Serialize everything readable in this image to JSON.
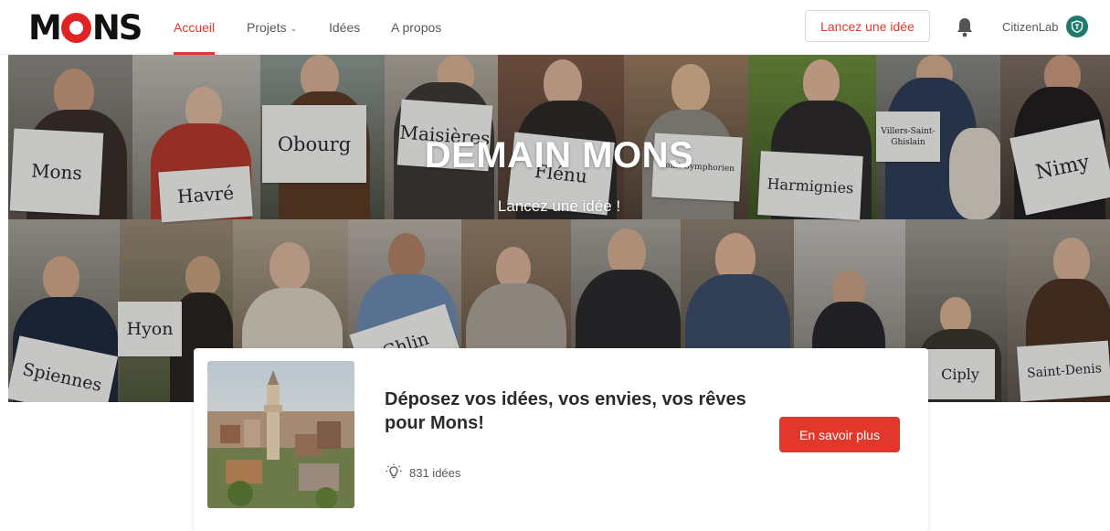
{
  "brand": {
    "logo_text_left": "M",
    "logo_text_right": "NS",
    "accent": "#e2382c"
  },
  "nav": {
    "items": [
      {
        "label": "Accueil"
      },
      {
        "label": "Projets"
      },
      {
        "label": "Idées"
      },
      {
        "label": "A propos"
      }
    ],
    "cta_label": "Lancez une idée",
    "bell_icon": "bell-icon",
    "user_name": "CitizenLab"
  },
  "hero": {
    "title": "DEMAIN MONS",
    "subtitle": "Lancez une idée !",
    "signs": [
      "Mons",
      "Havré",
      "Obourg",
      "Maisières",
      "Flénu",
      "Saint-Symphorien",
      "Harmignies",
      "Villers-Saint-Ghislain",
      "Nimy",
      "Hyon",
      "Ghlin",
      "Spiennes",
      "Ciply",
      "Saint-Denis"
    ]
  },
  "project": {
    "title": "Déposez vos idées, vos envies, vos rêves pour Mons!",
    "stat": "831 idées",
    "button_label": "En savoir plus"
  }
}
